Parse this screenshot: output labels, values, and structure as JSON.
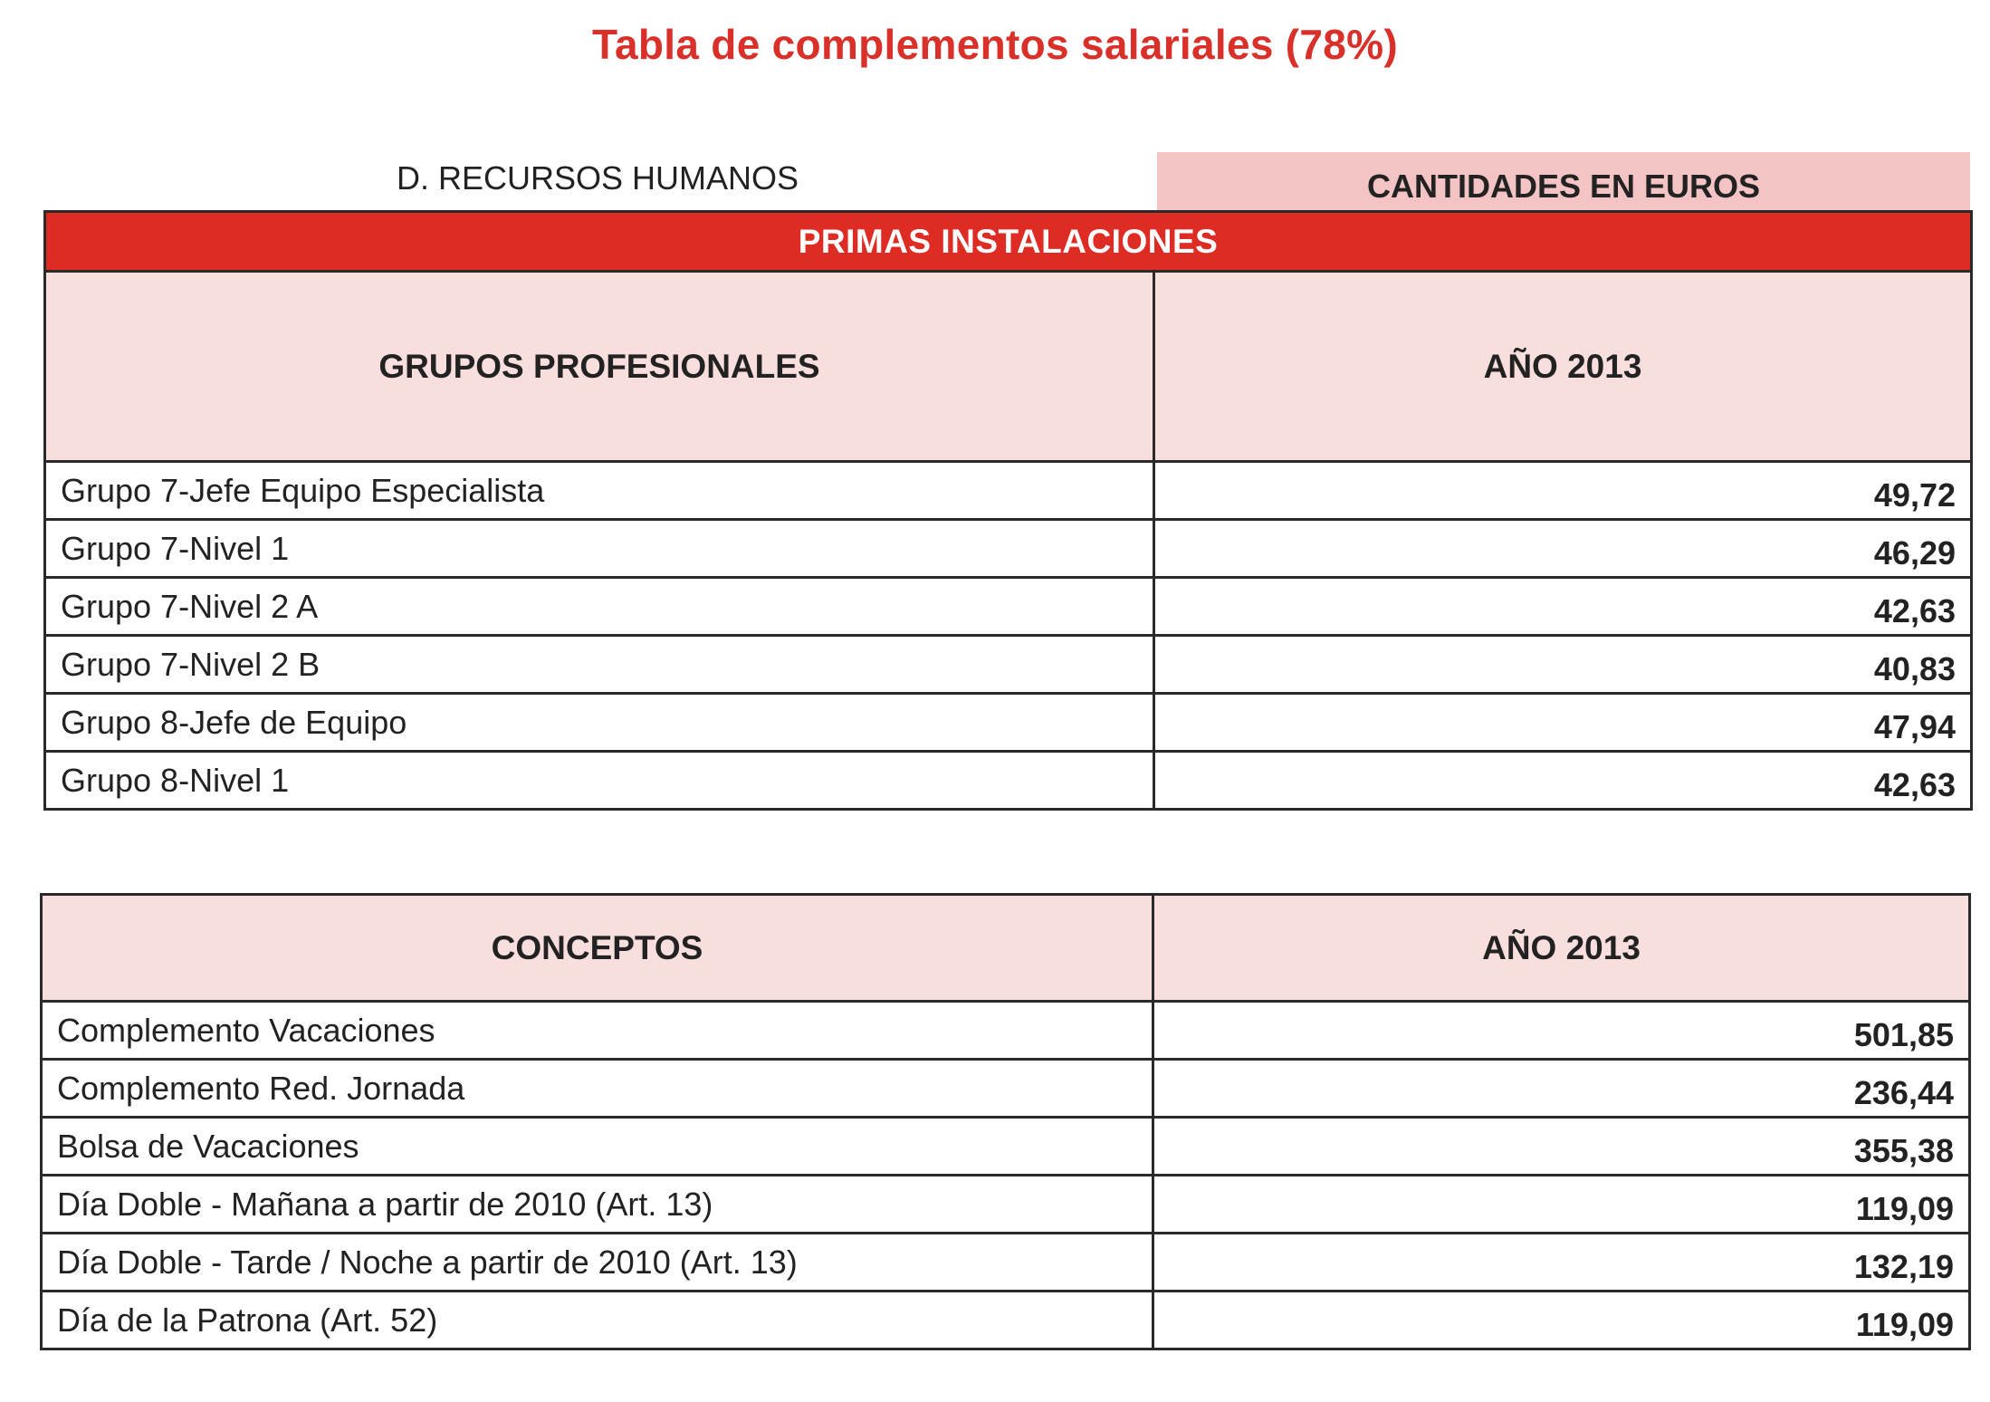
{
  "title": "Tabla de complementos salariales (78%)",
  "department": "D. RECURSOS HUMANOS",
  "units_label": "CANTIDADES EN EUROS",
  "colors": {
    "accent_red": "#de2b24",
    "title_red": "#d9302a",
    "header_pink": "#f9dede",
    "units_pink": "#f4c4c4"
  },
  "primas": {
    "section_title": "PRIMAS INSTALACIONES",
    "headers": [
      "GRUPOS PROFESIONALES",
      "AÑO 2013"
    ],
    "rows": [
      [
        "Grupo 7-Jefe Equipo Especialista",
        "49,72"
      ],
      [
        "Grupo 7-Nivel 1",
        "46,29"
      ],
      [
        "Grupo 7-Nivel 2 A",
        "42,63"
      ],
      [
        "Grupo 7-Nivel 2 B",
        "40,83"
      ],
      [
        "Grupo 8-Jefe de Equipo",
        "47,94"
      ],
      [
        "Grupo 8-Nivel 1",
        "42,63"
      ]
    ]
  },
  "conceptos": {
    "headers": [
      "CONCEPTOS",
      "AÑO 2013"
    ],
    "rows": [
      [
        "Complemento Vacaciones",
        "501,85"
      ],
      [
        "Complemento Red. Jornada",
        "236,44"
      ],
      [
        "Bolsa de Vacaciones",
        "355,38"
      ],
      [
        "Día Doble - Mañana a partir de 2010 (Art. 13)",
        "119,09"
      ],
      [
        "Día Doble - Tarde / Noche a partir de 2010 (Art. 13)",
        "132,19"
      ],
      [
        "Día de la Patrona (Art. 52)",
        "119,09"
      ]
    ]
  }
}
